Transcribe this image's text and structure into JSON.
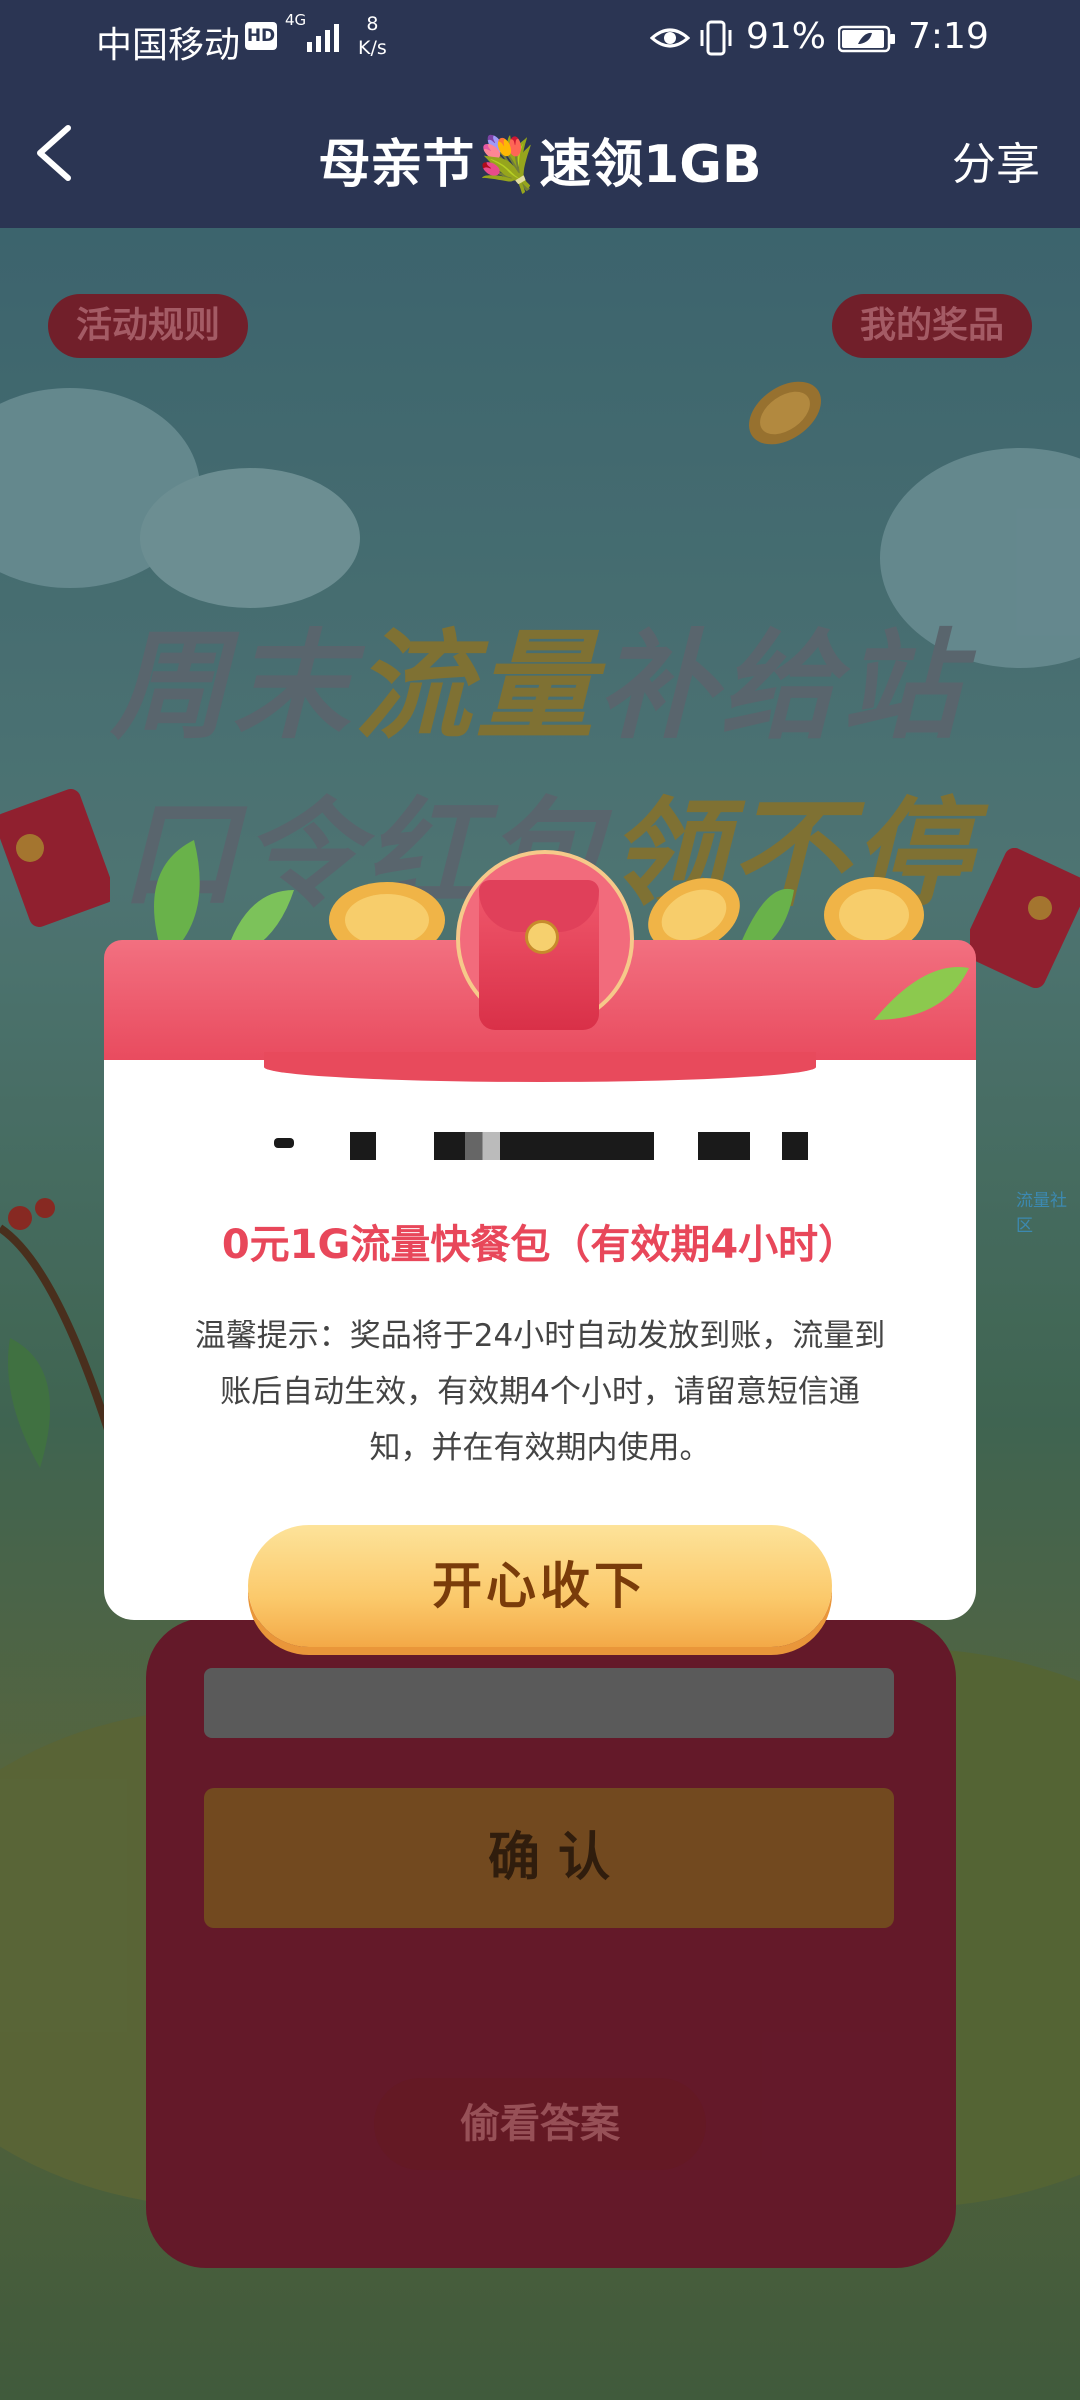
{
  "status": {
    "carrier": "中国移动",
    "hd": "HD",
    "network": "4G",
    "speed_value": "8",
    "speed_unit": "K/s",
    "battery_pct": "91%",
    "time": "7:19"
  },
  "nav": {
    "title": "母亲节💐速领1GB",
    "share": "分享"
  },
  "background": {
    "rules_button": "活动规则",
    "prizes_button": "我的奖品",
    "headline_line1_a": "周末",
    "headline_line1_b": "流量",
    "headline_line1_c": "补给站",
    "headline_line2_a": "口令红包",
    "headline_line2_b": "领不停",
    "confirm_button": "确 认",
    "peek_answer_button": "偷看答案",
    "side_tag": "流量社区"
  },
  "modal": {
    "prize_title": "0元1G流量快餐包（有效期4小时）",
    "tip_line1": "温馨提示：奖品将于24小时自动发放到账，流量到",
    "tip_line2": "账后自动生效，有效期4个小时，请留意短信通",
    "tip_line3": "知，并在有效期内使用。",
    "accept_button": "开心收下"
  }
}
